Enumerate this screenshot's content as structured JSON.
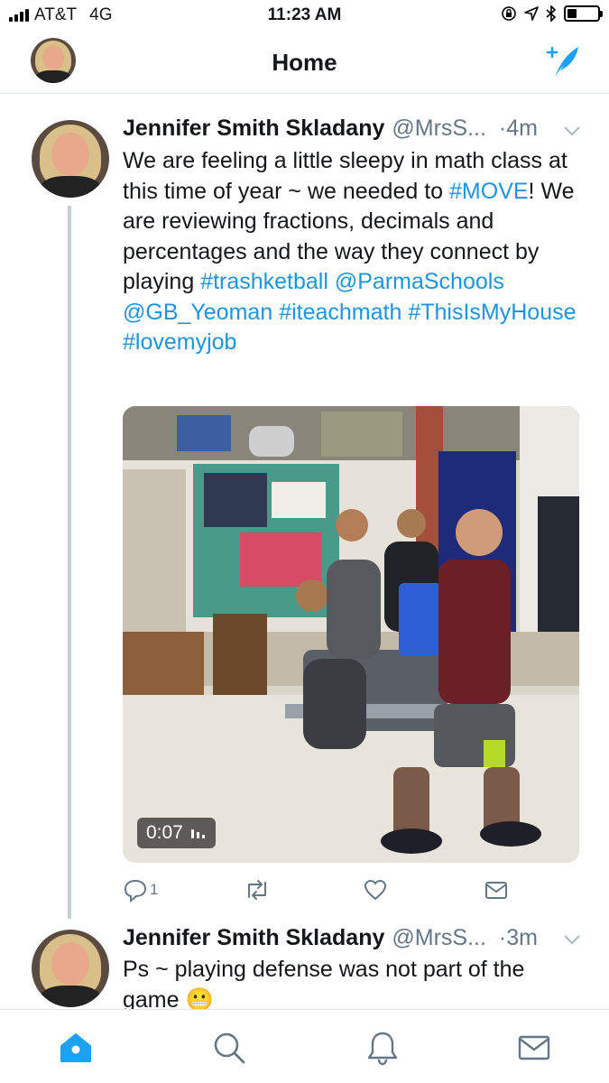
{
  "status_bar": {
    "carrier": "AT&T",
    "network": "4G",
    "time": "11:23 AM"
  },
  "header": {
    "title": "Home",
    "compose_icon": "compose-tweet-icon"
  },
  "tweets": [
    {
      "name": "Jennifer Smith Skladany",
      "handle": "@MrsS...",
      "time": "·4m",
      "text_segments": [
        {
          "text": "We are feeling a little sleepy in math class at this time of year ~ we needed to ",
          "link": false
        },
        {
          "text": "#MOVE",
          "link": true
        },
        {
          "text": "! We are reviewing fractions, decimals and percentages and the way they connect by playing ",
          "link": false
        },
        {
          "text": "#trashketball",
          "link": true
        },
        {
          "text": " ",
          "link": false
        },
        {
          "text": "@ParmaSchools",
          "link": true
        },
        {
          "text": " ",
          "link": false
        },
        {
          "text": "@GB_Yeoman",
          "link": true
        },
        {
          "text": " ",
          "link": false
        },
        {
          "text": "#iteachmath",
          "link": true
        },
        {
          "text": " ",
          "link": false
        },
        {
          "text": "#ThisIsMyHouse",
          "link": true
        },
        {
          "text": " ",
          "link": false
        },
        {
          "text": "#lovemyjob",
          "link": true
        }
      ],
      "media": {
        "duration": "0:07"
      },
      "actions": {
        "reply_count": "1"
      }
    },
    {
      "name": "Jennifer Smith Skladany",
      "handle": "@MrsS...",
      "time": "·3m",
      "text_segments": [
        {
          "text": "Ps ~ playing defense was not part of the game 😬",
          "link": false
        }
      ]
    }
  ],
  "tabbar": {
    "items": [
      "home-icon",
      "search-icon",
      "notifications-icon",
      "messages-icon"
    ],
    "active": "home-icon"
  },
  "colors": {
    "accent": "#1da1f2",
    "link": "#1b95e0",
    "secondary_text": "#657786",
    "thread_line": "#c4cfd6"
  }
}
